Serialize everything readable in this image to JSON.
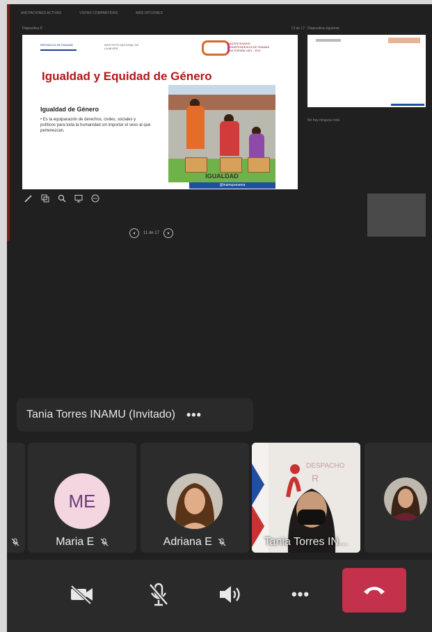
{
  "presentation": {
    "toolbar_items": [
      "ANOTACIONES ACTIVAS",
      "VISTAS COMPARTIDAS",
      "MÁS OPCIONES"
    ],
    "slide_header_left": "Diapositiva 8",
    "slide_header_right": "13 de 17",
    "slide": {
      "title": "Igualdad y Equidad de Género",
      "subtitle": "Igualdad de Género",
      "body": "Es la equiparación de derechos, civiles, sociales y políticos para toda la humanidad sin importar el sexo al que pertenezcan.",
      "logo_left": "REPÚBLICA DE PANAMÁ",
      "logo_middle": "INSTITUTO NACIONAL DE LA MUJER",
      "logo_right": "BICENTENARIO INDEPENDENCIA DE PANAMÁ DE ESPAÑA 1821 - 2021",
      "image_label": "IGUALDAD",
      "footer": "@inamupanama"
    },
    "page_indicator": "11 de 17",
    "side_label": "Diapositiva siguiente",
    "side_note": "No hay ninguna nota"
  },
  "presenter_bar": {
    "name": "Tania Torres INAMU (Invitado)",
    "more_label": "•••"
  },
  "participants": [
    {
      "name": "Maria E",
      "initials": "ME",
      "muted": true
    },
    {
      "name": "Adriana E",
      "muted": true
    },
    {
      "name": "Tania Torres IN...",
      "muted": false
    }
  ],
  "controls": {
    "more_label": "•••"
  },
  "colors": {
    "background": "#202020",
    "tile": "#2c2c2c",
    "hangup": "#c4314b",
    "slide_title": "#b01818"
  }
}
